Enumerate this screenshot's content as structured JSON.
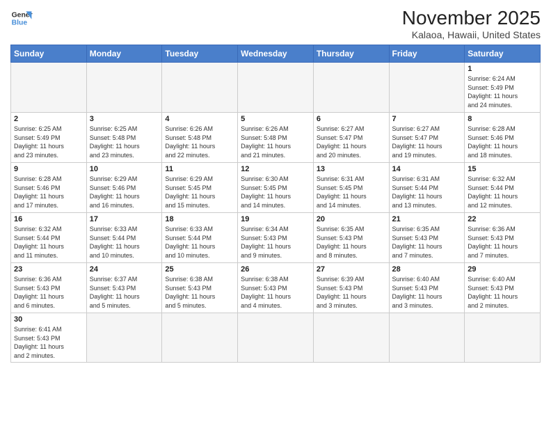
{
  "header": {
    "logo_line1": "General",
    "logo_line2": "Blue",
    "month": "November 2025",
    "location": "Kalaoa, Hawaii, United States"
  },
  "weekdays": [
    "Sunday",
    "Monday",
    "Tuesday",
    "Wednesday",
    "Thursday",
    "Friday",
    "Saturday"
  ],
  "weeks": [
    [
      {
        "num": "",
        "info": ""
      },
      {
        "num": "",
        "info": ""
      },
      {
        "num": "",
        "info": ""
      },
      {
        "num": "",
        "info": ""
      },
      {
        "num": "",
        "info": ""
      },
      {
        "num": "",
        "info": ""
      },
      {
        "num": "1",
        "info": "Sunrise: 6:24 AM\nSunset: 5:49 PM\nDaylight: 11 hours\nand 24 minutes."
      }
    ],
    [
      {
        "num": "2",
        "info": "Sunrise: 6:25 AM\nSunset: 5:49 PM\nDaylight: 11 hours\nand 23 minutes."
      },
      {
        "num": "3",
        "info": "Sunrise: 6:25 AM\nSunset: 5:48 PM\nDaylight: 11 hours\nand 23 minutes."
      },
      {
        "num": "4",
        "info": "Sunrise: 6:26 AM\nSunset: 5:48 PM\nDaylight: 11 hours\nand 22 minutes."
      },
      {
        "num": "5",
        "info": "Sunrise: 6:26 AM\nSunset: 5:48 PM\nDaylight: 11 hours\nand 21 minutes."
      },
      {
        "num": "6",
        "info": "Sunrise: 6:27 AM\nSunset: 5:47 PM\nDaylight: 11 hours\nand 20 minutes."
      },
      {
        "num": "7",
        "info": "Sunrise: 6:27 AM\nSunset: 5:47 PM\nDaylight: 11 hours\nand 19 minutes."
      },
      {
        "num": "8",
        "info": "Sunrise: 6:28 AM\nSunset: 5:46 PM\nDaylight: 11 hours\nand 18 minutes."
      }
    ],
    [
      {
        "num": "9",
        "info": "Sunrise: 6:28 AM\nSunset: 5:46 PM\nDaylight: 11 hours\nand 17 minutes."
      },
      {
        "num": "10",
        "info": "Sunrise: 6:29 AM\nSunset: 5:46 PM\nDaylight: 11 hours\nand 16 minutes."
      },
      {
        "num": "11",
        "info": "Sunrise: 6:29 AM\nSunset: 5:45 PM\nDaylight: 11 hours\nand 15 minutes."
      },
      {
        "num": "12",
        "info": "Sunrise: 6:30 AM\nSunset: 5:45 PM\nDaylight: 11 hours\nand 14 minutes."
      },
      {
        "num": "13",
        "info": "Sunrise: 6:31 AM\nSunset: 5:45 PM\nDaylight: 11 hours\nand 14 minutes."
      },
      {
        "num": "14",
        "info": "Sunrise: 6:31 AM\nSunset: 5:44 PM\nDaylight: 11 hours\nand 13 minutes."
      },
      {
        "num": "15",
        "info": "Sunrise: 6:32 AM\nSunset: 5:44 PM\nDaylight: 11 hours\nand 12 minutes."
      }
    ],
    [
      {
        "num": "16",
        "info": "Sunrise: 6:32 AM\nSunset: 5:44 PM\nDaylight: 11 hours\nand 11 minutes."
      },
      {
        "num": "17",
        "info": "Sunrise: 6:33 AM\nSunset: 5:44 PM\nDaylight: 11 hours\nand 10 minutes."
      },
      {
        "num": "18",
        "info": "Sunrise: 6:33 AM\nSunset: 5:44 PM\nDaylight: 11 hours\nand 10 minutes."
      },
      {
        "num": "19",
        "info": "Sunrise: 6:34 AM\nSunset: 5:43 PM\nDaylight: 11 hours\nand 9 minutes."
      },
      {
        "num": "20",
        "info": "Sunrise: 6:35 AM\nSunset: 5:43 PM\nDaylight: 11 hours\nand 8 minutes."
      },
      {
        "num": "21",
        "info": "Sunrise: 6:35 AM\nSunset: 5:43 PM\nDaylight: 11 hours\nand 7 minutes."
      },
      {
        "num": "22",
        "info": "Sunrise: 6:36 AM\nSunset: 5:43 PM\nDaylight: 11 hours\nand 7 minutes."
      }
    ],
    [
      {
        "num": "23",
        "info": "Sunrise: 6:36 AM\nSunset: 5:43 PM\nDaylight: 11 hours\nand 6 minutes."
      },
      {
        "num": "24",
        "info": "Sunrise: 6:37 AM\nSunset: 5:43 PM\nDaylight: 11 hours\nand 5 minutes."
      },
      {
        "num": "25",
        "info": "Sunrise: 6:38 AM\nSunset: 5:43 PM\nDaylight: 11 hours\nand 5 minutes."
      },
      {
        "num": "26",
        "info": "Sunrise: 6:38 AM\nSunset: 5:43 PM\nDaylight: 11 hours\nand 4 minutes."
      },
      {
        "num": "27",
        "info": "Sunrise: 6:39 AM\nSunset: 5:43 PM\nDaylight: 11 hours\nand 3 minutes."
      },
      {
        "num": "28",
        "info": "Sunrise: 6:40 AM\nSunset: 5:43 PM\nDaylight: 11 hours\nand 3 minutes."
      },
      {
        "num": "29",
        "info": "Sunrise: 6:40 AM\nSunset: 5:43 PM\nDaylight: 11 hours\nand 2 minutes."
      }
    ],
    [
      {
        "num": "30",
        "info": "Sunrise: 6:41 AM\nSunset: 5:43 PM\nDaylight: 11 hours\nand 2 minutes."
      },
      {
        "num": "",
        "info": ""
      },
      {
        "num": "",
        "info": ""
      },
      {
        "num": "",
        "info": ""
      },
      {
        "num": "",
        "info": ""
      },
      {
        "num": "",
        "info": ""
      },
      {
        "num": "",
        "info": ""
      }
    ]
  ]
}
